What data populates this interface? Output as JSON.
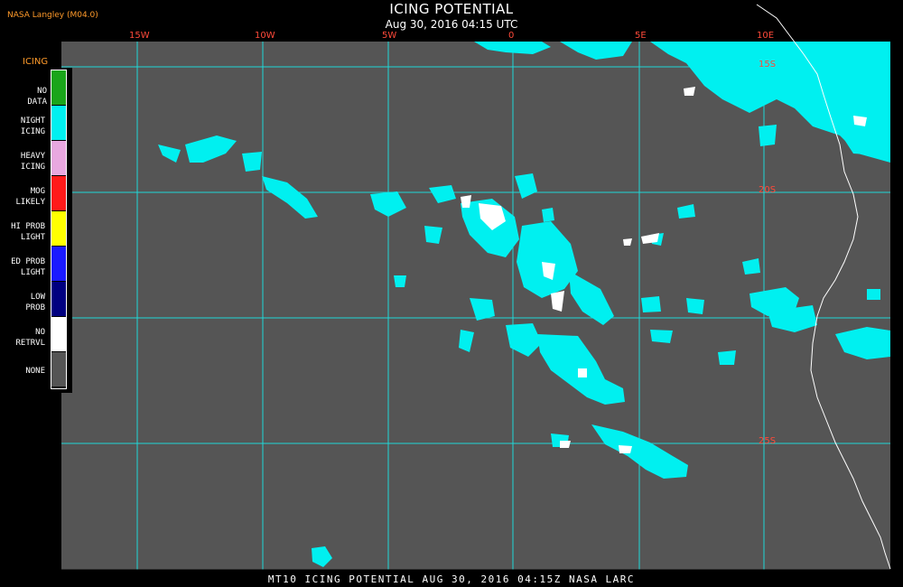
{
  "header": {
    "title": "ICING POTENTIAL",
    "date": "Aug 30, 2016 04:15 UTC",
    "provider": "NASA Langley (M04.0)"
  },
  "legend": {
    "title": "ICING",
    "items": [
      {
        "label": "NO DATA",
        "color": "#1aa51a"
      },
      {
        "label": "NIGHT ICING",
        "color": "#00f0f0"
      },
      {
        "label": "HEAVY ICING",
        "color": "#e8a8e0"
      },
      {
        "label": "MOG LIKELY",
        "color": "#ff1a1a"
      },
      {
        "label": "HI PROB LIGHT",
        "color": "#ffff00"
      },
      {
        "label": "ED PROB LIGHT",
        "color": "#1a1aff"
      },
      {
        "label": "LOW PROB",
        "color": "#000080"
      },
      {
        "label": "NO RETRVL",
        "color": "#ffffff"
      },
      {
        "label": "NONE",
        "color": "#555555"
      }
    ]
  },
  "map": {
    "background_color": "#555555",
    "grid_color": "#20d8d8",
    "coastline_color": "#ffffff",
    "longitude_labels": [
      "15W",
      "10W",
      "5W",
      "0",
      "5E",
      "10E"
    ],
    "latitude_labels": [
      "15S",
      "20S",
      "25S"
    ]
  },
  "footer": {
    "text": "MT10  ICING POTENTIAL   AUG 30, 2016 04:15Z   NASA LARC"
  }
}
